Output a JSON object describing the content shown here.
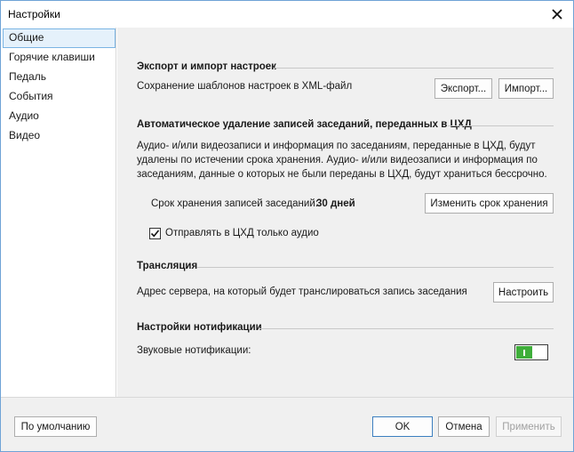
{
  "window": {
    "title": "Настройки"
  },
  "sidebar": {
    "items": [
      {
        "label": "Общие",
        "active": true
      },
      {
        "label": "Горячие клавиши"
      },
      {
        "label": "Педаль"
      },
      {
        "label": "События"
      },
      {
        "label": "Аудио"
      },
      {
        "label": "Видео"
      }
    ]
  },
  "export_section": {
    "title": "Экспорт и импорт настроек",
    "description": "Сохранение шаблонов настроек в XML-файл",
    "export_label": "Экспорт...",
    "import_label": "Импорт..."
  },
  "autodelete_section": {
    "title": "Автоматическое удаление записей заседаний, переданных в ЦХД",
    "paragraph_lines": [
      "Аудио- и/или видеозаписи и информация по заседаниям, переданные в ЦХД, будут",
      "удалены по истечении срока хранения. Аудио- и/или видеозаписи и информация по",
      "заседаниям, данные о которых не были переданы в ЦХД, будут храниться бессрочно."
    ],
    "retention_label": "Срок хранения записей заседаний:",
    "retention_value": "30 дней",
    "change_retention_label": "Изменить срок хранения",
    "audio_only_label": "Отправлять в ЦХД только аудио",
    "audio_only_checked": true
  },
  "broadcast_section": {
    "title": "Трансляция",
    "description": "Адрес сервера, на который будет транслироваться запись заседания",
    "configure_label": "Настроить"
  },
  "notifications_section": {
    "title": "Настройки нотификации",
    "sound_label": "Звуковые нотификации:",
    "sound_enabled": true,
    "toggle_color": "#3fae3a"
  },
  "footer": {
    "defaults_label": "По умолчанию",
    "ok_label": "OK",
    "cancel_label": "Отмена",
    "apply_label": "Применить"
  },
  "colors": {
    "accent_border": "#7ab4e3",
    "active_item_bg": "#e5f1fb",
    "content_bg": "#f0f0f0"
  }
}
